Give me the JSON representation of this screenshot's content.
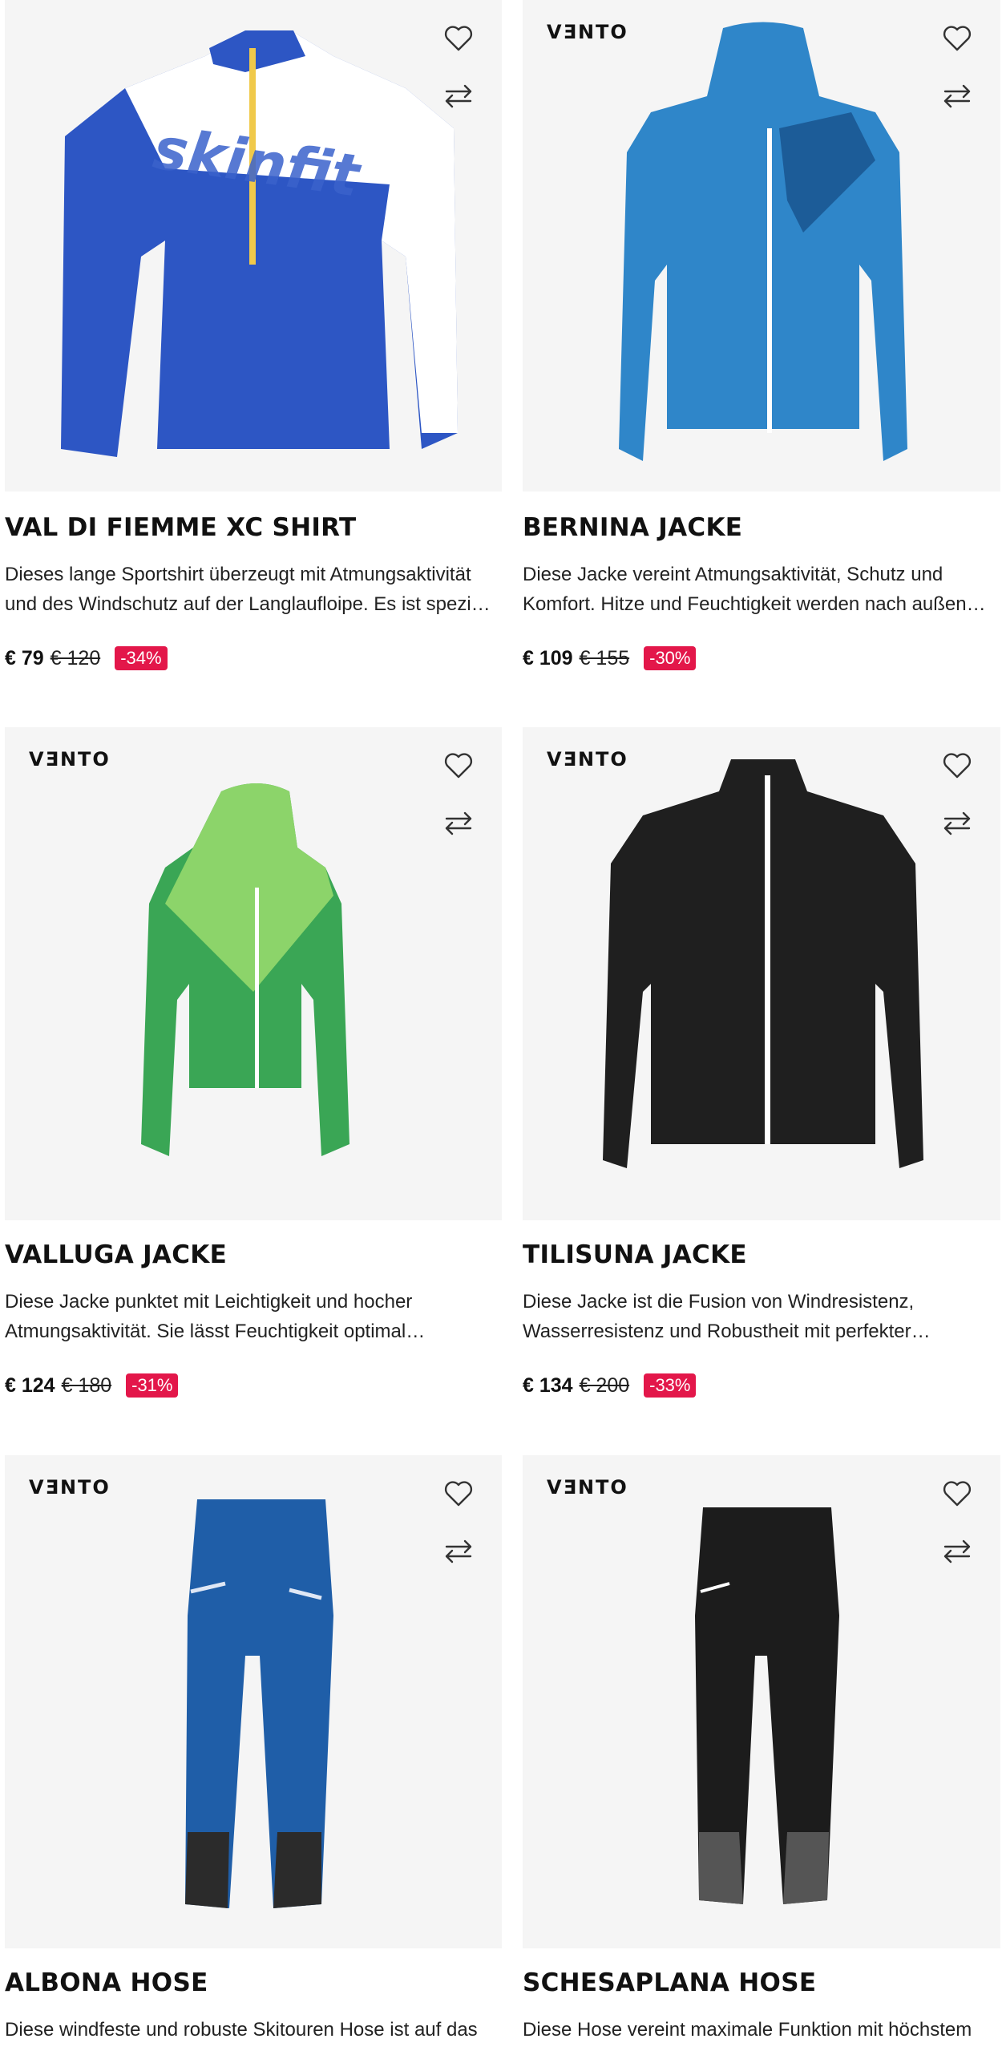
{
  "colors": {
    "sale_badge": "#e3174a",
    "card_bg": "#f5f5f5"
  },
  "products": [
    {
      "brand": "",
      "title": "VAL DI FIEMME XC SHIRT",
      "description": "Dieses lange Sportshirt überzeugt mit Atmungsaktivität und des Windschutz auf der Langlaufloipe. Es ist spezi…",
      "price_now": "€ 79",
      "price_old": "€ 120",
      "discount": "-34%",
      "image_label": "skinfit",
      "icons": {
        "favorite": "heart-icon",
        "compare": "compare-arrows-icon"
      }
    },
    {
      "brand": "VƎNTO",
      "title": "BERNINA JACKE",
      "description": "Diese Jacke vereint Atmungsaktivität, Schutz und Komfort. Hitze und Feuchtigkeit werden nach außen…",
      "price_now": "€ 109",
      "price_old": "€ 155",
      "discount": "-30%",
      "icons": {
        "favorite": "heart-icon",
        "compare": "compare-arrows-icon"
      }
    },
    {
      "brand": "VƎNTO",
      "title": "VALLUGA JACKE",
      "description": "Diese Jacke punktet mit Leichtigkeit und hocher Atmungsaktivität. Sie lässt Feuchtigkeit optimal…",
      "price_now": "€ 124",
      "price_old": "€ 180",
      "discount": "-31%",
      "icons": {
        "favorite": "heart-icon",
        "compare": "compare-arrows-icon"
      }
    },
    {
      "brand": "VƎNTO",
      "title": "TILISUNA JACKE",
      "description": "Diese Jacke ist die Fusion von Windresistenz, Wasserresistenz und Robustheit mit perfekter…",
      "price_now": "€ 134",
      "price_old": "€ 200",
      "discount": "-33%",
      "icons": {
        "favorite": "heart-icon",
        "compare": "compare-arrows-icon"
      }
    },
    {
      "brand": "VƎNTO",
      "title": "ALBONA HOSE",
      "description": "Diese windfeste und robuste Skitouren Hose ist auf das",
      "price_now": "",
      "price_old": "",
      "discount": "",
      "icons": {
        "favorite": "heart-icon",
        "compare": "compare-arrows-icon"
      }
    },
    {
      "brand": "VƎNTO",
      "title": "SCHESAPLANA HOSE",
      "description": "Diese Hose vereint maximale Funktion mit höchstem",
      "price_now": "",
      "price_old": "",
      "discount": "",
      "icons": {
        "favorite": "heart-icon",
        "compare": "compare-arrows-icon"
      }
    }
  ]
}
